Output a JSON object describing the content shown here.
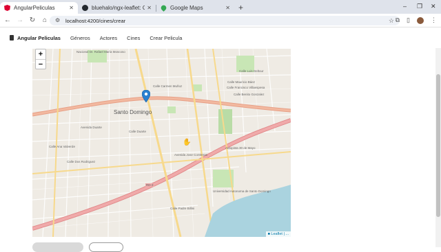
{
  "browser": {
    "tabs": [
      {
        "title": "AngularPeliculas",
        "active": true,
        "favicon_color": "#dd0031"
      },
      {
        "title": "bluehalo/ngx-leaflet: Core Leafl...",
        "active": false,
        "favicon_color": "#24292f"
      },
      {
        "title": "Google Maps",
        "active": false,
        "favicon_color": "#34a853"
      }
    ],
    "new_tab": "+",
    "url": "localhost:4200/cines/crear",
    "window_controls": [
      "–",
      "❐",
      "✕"
    ]
  },
  "app_nav": {
    "brand": "Angular Peliculas",
    "links": [
      "Géneros",
      "Actores",
      "Cines",
      "Crear Pelicula"
    ]
  },
  "map": {
    "zoom_in": "+",
    "zoom_out": "−",
    "attribution": "■ Leaflet | ...",
    "city_label": "Santo Domingo",
    "labels": [
      "Nacional Dr. Rafael María Moscoso",
      "Calle Luis Deltour",
      "Calle Carmen Muñoz",
      "Calle Mauricio Báez",
      "Calle Francisco Villaespesa",
      "Calle Benito Gonzalez",
      "Avenida Duarte",
      "Calle Ana Valverde",
      "Calle Dos Rodriguez",
      "Calle Duarte",
      "RD-3",
      "Avenida Jose Contreras",
      "Autopista 30 de Mayo",
      "Universidad Autonoma de Santo Domingo",
      "Calle Padre Billini"
    ],
    "pin_color": "#2a7fd0",
    "water_color": "#aad3df",
    "park_color": "#c8e6b5"
  },
  "buttons": {
    "primary": "",
    "secondary": ""
  }
}
